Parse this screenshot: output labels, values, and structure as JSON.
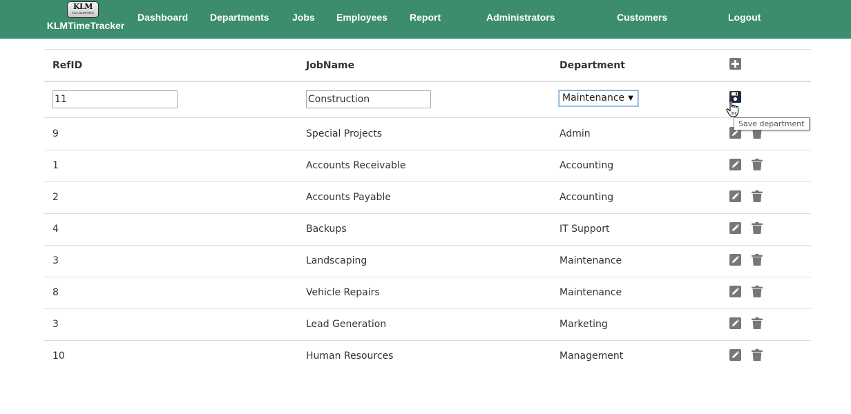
{
  "brand": {
    "logo_text": "KLM",
    "logo_subtext": "ACCOUNTING",
    "name": "KLMTimeTracker"
  },
  "nav": {
    "items": [
      "Dashboard",
      "Departments",
      "Jobs",
      "Employees",
      "Report",
      "Administrators",
      "Customers",
      "Logout"
    ]
  },
  "table": {
    "headers": {
      "refid": "RefID",
      "jobname": "JobName",
      "department": "Department"
    },
    "edit_row": {
      "refid_value": "11",
      "jobname_value": "Construction",
      "department_selected": "Maintenance"
    },
    "rows": [
      {
        "refid": "9",
        "jobname": "Special Projects",
        "department": "Admin"
      },
      {
        "refid": "1",
        "jobname": "Accounts Receivable",
        "department": "Accounting"
      },
      {
        "refid": "2",
        "jobname": "Accounts Payable",
        "department": "Accounting"
      },
      {
        "refid": "4",
        "jobname": "Backups",
        "department": "IT Support"
      },
      {
        "refid": "3",
        "jobname": "Landscaping",
        "department": "Maintenance"
      },
      {
        "refid": "8",
        "jobname": "Vehicle Repairs",
        "department": "Maintenance"
      },
      {
        "refid": "3",
        "jobname": "Lead Generation",
        "department": "Marketing"
      },
      {
        "refid": "10",
        "jobname": "Human Resources",
        "department": "Management"
      }
    ]
  },
  "tooltip": "Save department",
  "icons": {
    "add": "plus-square-icon",
    "save": "floppy-disk-icon",
    "edit": "pencil-square-icon",
    "delete": "trash-icon",
    "cursor": "hand-pointer-icon"
  },
  "colors": {
    "navbar": "#3c8c6e",
    "icon_gray": "#777777",
    "save_icon": "#1f2d3a"
  }
}
